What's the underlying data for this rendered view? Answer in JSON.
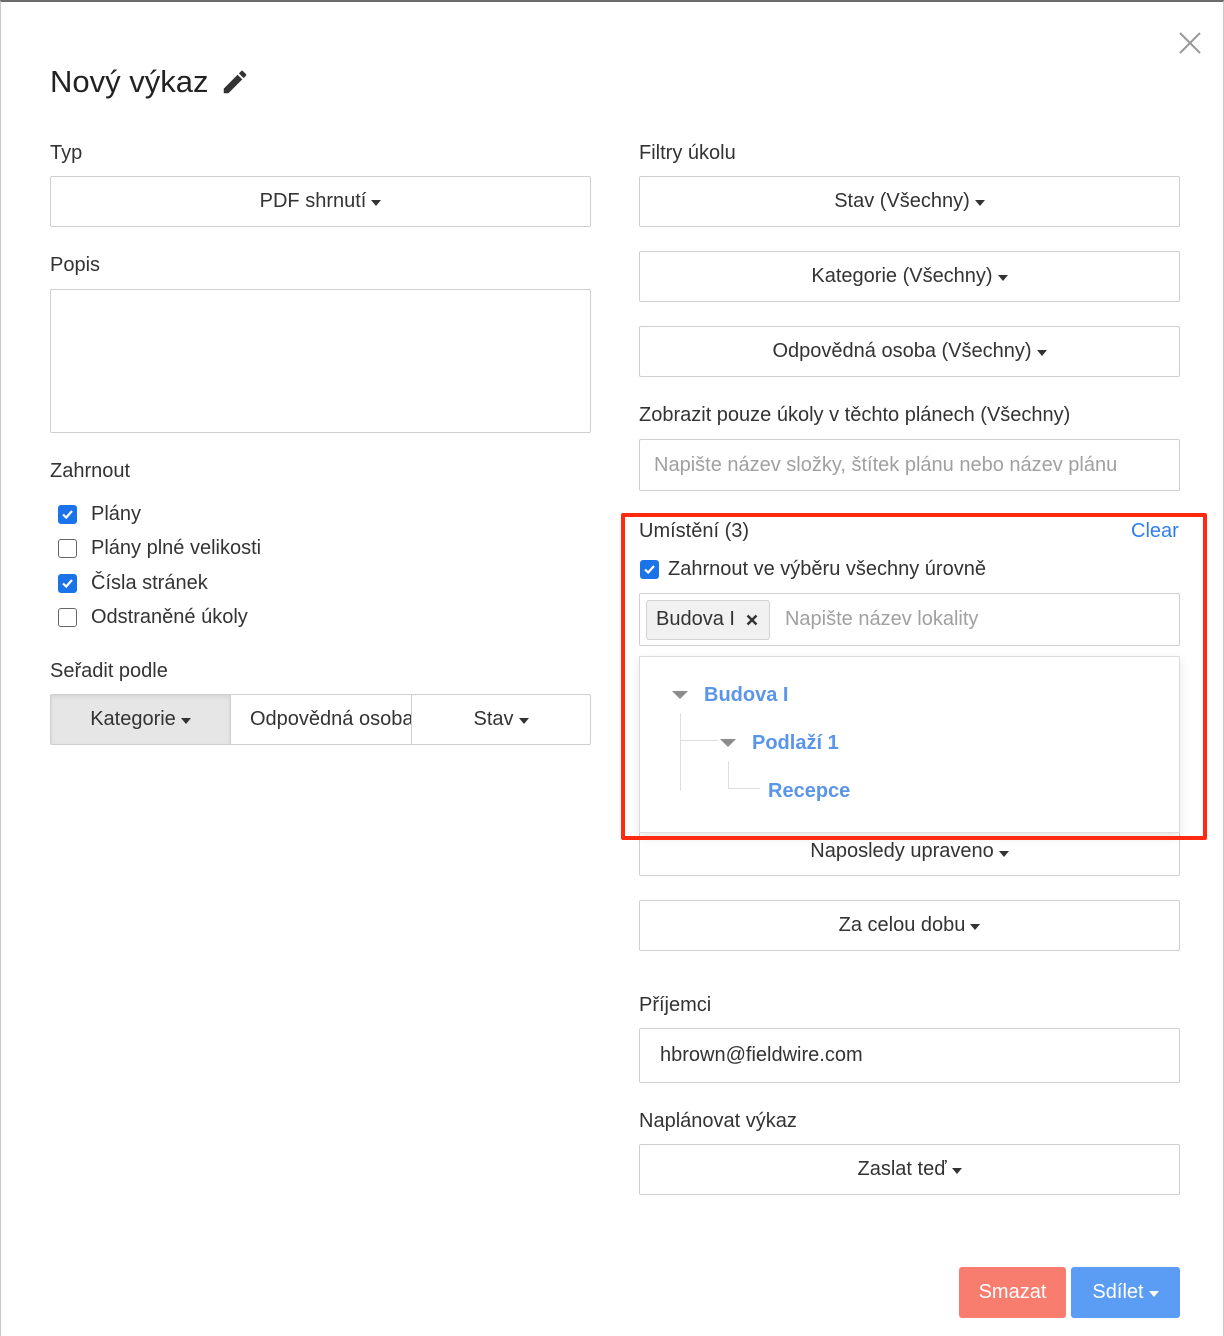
{
  "header": {
    "title": "Nový výkaz"
  },
  "left": {
    "type_label": "Typ",
    "type_value": "PDF shrnutí",
    "description_label": "Popis",
    "include_label": "Zahrnout",
    "include_options": [
      {
        "label": "Plány",
        "checked": true
      },
      {
        "label": "Plány plné velikosti",
        "checked": false
      },
      {
        "label": "Čísla stránek",
        "checked": true
      },
      {
        "label": "Odstraněné úkoly",
        "checked": false
      }
    ],
    "sort_label": "Seřadit podle",
    "sort_options": [
      "Kategorie",
      "Odpovědná osoba",
      "Stav"
    ],
    "sort_active": "Kategorie"
  },
  "right": {
    "filters_label": "Filtry úkolu",
    "status_filter": "Stav (Všechny)",
    "category_filter": "Kategorie (Všechny)",
    "assignee_filter": "Odpovědná osoba (Všechny)",
    "plans_label": "Zobrazit pouze úkoly v těchto plánech (Všechny)",
    "plans_placeholder": "Napište název složky, štítek plánu nebo název plánu",
    "location_label": "Umístění (3)",
    "clear_label": "Clear",
    "include_all_levels_label": "Zahrnout ve výběru všechny úrovně",
    "include_all_levels_checked": true,
    "location_tag": "Budova I",
    "location_placeholder": "Napište název lokality",
    "tree": {
      "building": "Budova I",
      "floor": "Podlaží 1",
      "room": "Recepce"
    },
    "modified_filter": "Naposledy upraveno",
    "period_filter": "Za celou dobu",
    "recipients_label": "Příjemci",
    "recipients_value": "hbrown@fieldwire.com",
    "schedule_label": "Naplánovat výkaz",
    "schedule_value": "Zaslat teď"
  },
  "footer": {
    "delete_label": "Smazat",
    "share_label": "Sdílet"
  },
  "colors": {
    "accent_blue": "#5b9cf5",
    "delete_red": "#f97d6f",
    "highlight_red": "#ff2a10",
    "tree_link": "#5a95ea",
    "checkbox_blue": "#1a73e8"
  }
}
